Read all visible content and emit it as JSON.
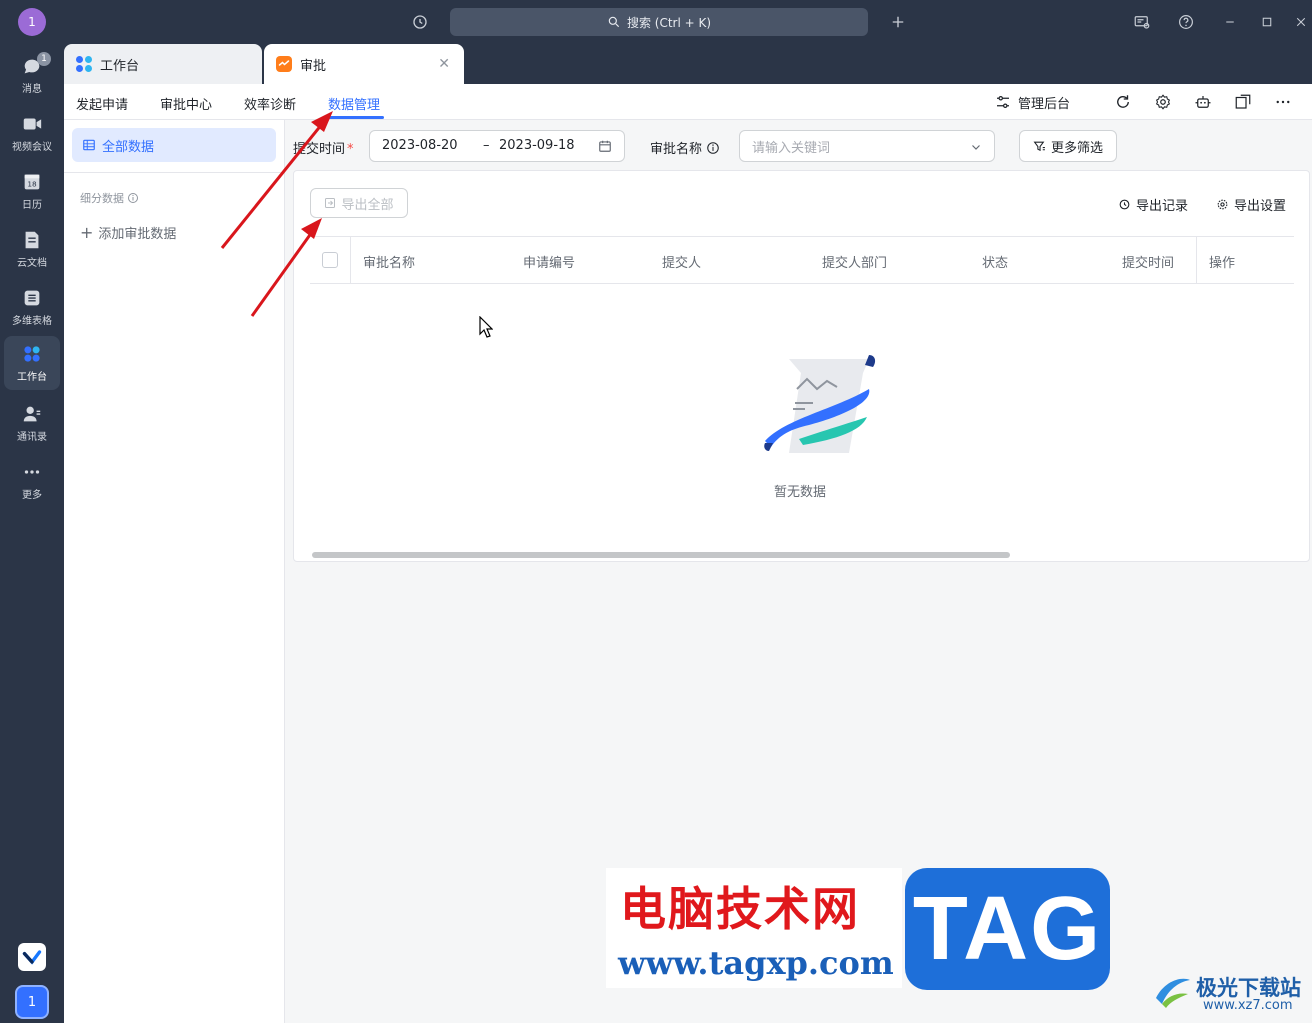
{
  "rail": {
    "avatar_top": "1",
    "items": [
      {
        "label": "消息",
        "badge": "1"
      },
      {
        "label": "视频会议"
      },
      {
        "label": "日历",
        "icon_text": "18"
      },
      {
        "label": "云文档"
      },
      {
        "label": "多维表格"
      },
      {
        "label": "工作台"
      },
      {
        "label": "通讯录"
      },
      {
        "label": "更多"
      }
    ],
    "user_badge": "1"
  },
  "titlebar": {
    "search_placeholder": "搜索 (Ctrl + K)"
  },
  "tabs": [
    {
      "label": "工作台"
    },
    {
      "label": "审批"
    }
  ],
  "nav": {
    "links": [
      "发起申请",
      "审批中心",
      "效率诊断",
      "数据管理"
    ],
    "active": "数据管理",
    "admin_label": "管理后台"
  },
  "sidebar": {
    "active_item": "全部数据",
    "sub_header": "细分数据",
    "add_item": "添加审批数据"
  },
  "filters": {
    "time_label": "提交时间",
    "required_mark": "*",
    "date_start": "2023-08-20",
    "date_sep": "–",
    "date_end": "2023-09-18",
    "name_label": "审批名称",
    "name_placeholder": "请输入关键词",
    "more_filter": "更多筛选"
  },
  "panel": {
    "export_all": "导出全部",
    "export_record": "导出记录",
    "export_settings": "导出设置",
    "columns": [
      "审批名称",
      "申请编号",
      "提交人",
      "提交人部门",
      "状态",
      "提交时间",
      "操作"
    ],
    "empty_text": "暂无数据"
  },
  "watermark": {
    "title": "电脑技术网",
    "url": "www.tagxp.com",
    "tag": "TAG",
    "logo_text": "极光下载站",
    "logo_url": "www.xz7.com"
  },
  "colors": {
    "accent": "#3370ff",
    "rail_bg": "#2b3547",
    "arrow": "#d9161c"
  }
}
